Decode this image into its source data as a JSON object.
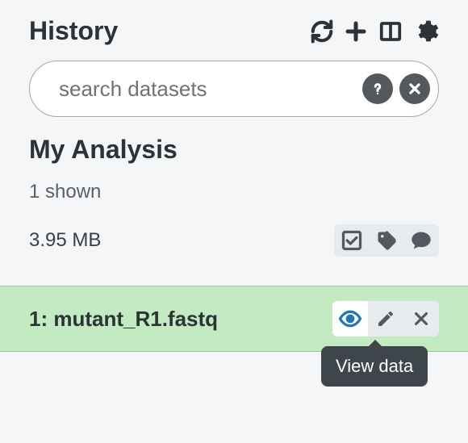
{
  "header": {
    "title": "History",
    "icons": {
      "refresh": "refresh-icon",
      "add": "plus-icon",
      "columns": "columns-icon",
      "settings": "gear-icon"
    }
  },
  "search": {
    "placeholder": "search datasets",
    "help_icon": "question-icon",
    "clear_icon": "close-icon"
  },
  "analysis": {
    "name": "My Analysis",
    "shown": "1 shown",
    "size": "3.95 MB",
    "meta_icons": {
      "select": "checkbox-icon",
      "tags": "tags-icon",
      "annotate": "comment-icon"
    }
  },
  "datasets": [
    {
      "hid": "1",
      "name": "mutant_R1.fastq",
      "label": "1: mutant_R1.fastq",
      "actions": {
        "view": "eye-icon",
        "edit": "pencil-icon",
        "delete": "close-icon"
      }
    }
  ],
  "tooltip": "View data"
}
